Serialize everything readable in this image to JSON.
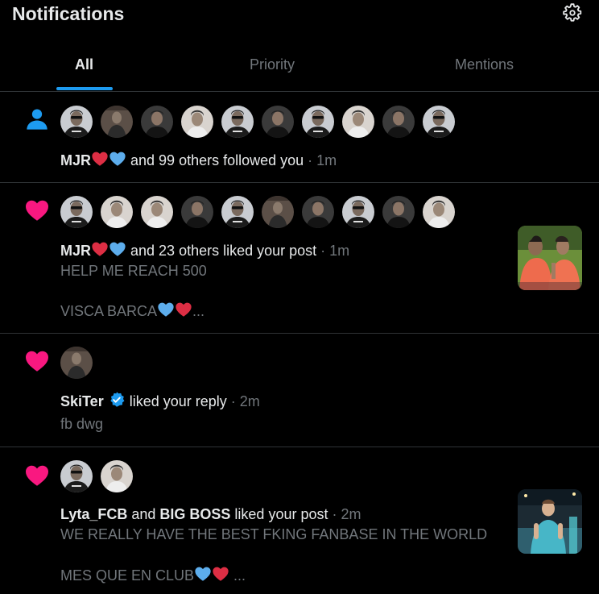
{
  "header": {
    "title": "Notifications",
    "settings_icon": "gear-icon"
  },
  "tabs": [
    {
      "label": "All",
      "active": true
    },
    {
      "label": "Priority",
      "active": false
    },
    {
      "label": "Mentions",
      "active": false
    }
  ],
  "colors": {
    "accent": "#1d9bf0",
    "like": "#f91880",
    "muted": "#71767b",
    "text": "#e7e9ea",
    "divider": "#2f3336"
  },
  "notifications": [
    {
      "type": "follow",
      "icon": "person-icon",
      "name": "MJR",
      "rest": " and 99 others followed you",
      "time": "1m"
    },
    {
      "type": "like",
      "icon": "heart-icon",
      "name": "MJR",
      "rest": " and 23 others liked your post",
      "time": "1m",
      "text1": "HELP ME REACH 500",
      "text2": "VISCA BARCA",
      "text2_suffix": "..."
    },
    {
      "type": "like",
      "icon": "heart-icon",
      "name": "SkiTer",
      "rest": "liked your reply",
      "time": "2m",
      "text1": "fb dwg"
    },
    {
      "type": "like",
      "icon": "heart-icon",
      "name": "Lyta_FCB",
      "and": " and ",
      "name2": "BIG BOSS",
      "rest": " liked your post",
      "time": "2m",
      "text1": "WE REALLY HAVE THE BEST FKING FANBASE IN THE WORLD",
      "text2": "MES QUE EN CLUB",
      "text2_suffix": " ..."
    }
  ],
  "dot": " · "
}
